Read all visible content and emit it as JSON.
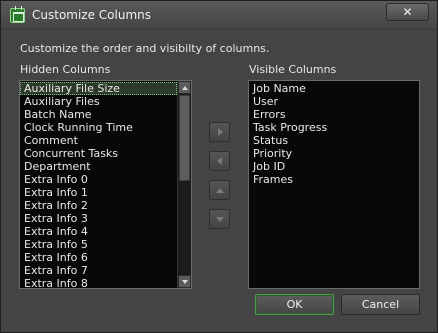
{
  "window": {
    "title": "Customize Columns",
    "close_glyph": "✕"
  },
  "description": "Customize the order and visibilty of columns.",
  "hidden": {
    "label": "Hidden Columns",
    "items": [
      "Auxiliary File Size",
      "Auxiliary Files",
      "Batch Name",
      "Clock Running Time",
      "Comment",
      "Concurrent Tasks",
      "Department",
      "Extra Info 0",
      "Extra Info 1",
      "Extra Info 2",
      "Extra Info 3",
      "Extra Info 4",
      "Extra Info 5",
      "Extra Info 6",
      "Extra Info 7",
      "Extra Info 8"
    ],
    "selected": "Auxiliary File Size"
  },
  "visible": {
    "label": "Visible Columns",
    "items": [
      "Job Name",
      "User",
      "Errors",
      "Task Progress",
      "Status",
      "Priority",
      "Job ID",
      "Frames"
    ]
  },
  "buttons": {
    "ok": "OK",
    "cancel": "Cancel"
  },
  "colors": {
    "accent": "#4c9a4c",
    "list_bg": "#080808",
    "window_bg": "#444444"
  }
}
